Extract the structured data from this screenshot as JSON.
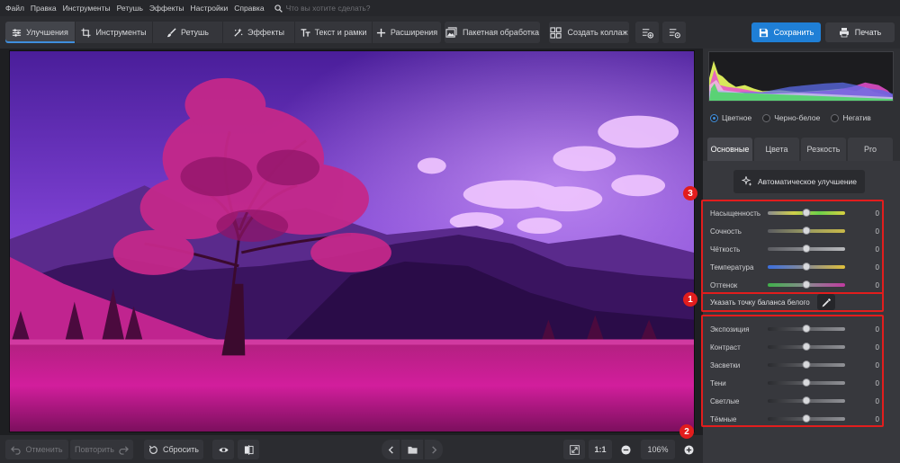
{
  "menu": {
    "items": [
      "Файл",
      "Правка",
      "Инструменты",
      "Ретушь",
      "Эффекты",
      "Настройки",
      "Справка"
    ],
    "search_placeholder": "Что вы хотите сделать?"
  },
  "toolbar": {
    "tabs": [
      {
        "label": "Улучшения",
        "icon": "sliders-icon"
      },
      {
        "label": "Инструменты",
        "icon": "crop-icon"
      },
      {
        "label": "Ретушь",
        "icon": "brush-icon"
      },
      {
        "label": "Эффекты",
        "icon": "sparkle-icon"
      },
      {
        "label": "Текст и рамки",
        "icon": "text-icon"
      },
      {
        "label": "Расширения",
        "icon": "plus-icon"
      }
    ],
    "batch_label": "Пакетная обработка",
    "collage_label": "Создать коллаж",
    "save_label": "Сохранить",
    "print_label": "Печать"
  },
  "bottombar": {
    "undo_label": "Отменить",
    "redo_label": "Повторить",
    "reset_label": "Сбросить",
    "ratio_label": "1:1",
    "zoom_value": "106%"
  },
  "panel": {
    "color_modes": [
      {
        "label": "Цветное",
        "selected": true
      },
      {
        "label": "Черно-белое",
        "selected": false
      },
      {
        "label": "Негатив",
        "selected": false
      }
    ],
    "tabs": [
      "Основные",
      "Цвета",
      "Резкость",
      "Pro"
    ],
    "auto_button": "Автоматическое улучшение",
    "white_balance_label": "Указать точку баланса белого",
    "sliders_color": [
      {
        "label": "Насыщенность",
        "value": "0",
        "level": 0.5
      },
      {
        "label": "Сочность",
        "value": "0",
        "level": 0.5
      },
      {
        "label": "Чёткость",
        "value": "0",
        "level": 0.5
      },
      {
        "label": "Температура",
        "value": "0",
        "level": 0.5
      },
      {
        "label": "Оттенок",
        "value": "0",
        "level": 0.5
      }
    ],
    "sliders_light": [
      {
        "label": "Экспозиция",
        "value": "0",
        "level": 0.5
      },
      {
        "label": "Контраст",
        "value": "0",
        "level": 0.5
      },
      {
        "label": "Засветки",
        "value": "0",
        "level": 0.5
      },
      {
        "label": "Тени",
        "value": "0",
        "level": 0.5
      },
      {
        "label": "Светлые",
        "value": "0",
        "level": 0.5
      },
      {
        "label": "Тёмные",
        "value": "0",
        "level": 0.5
      }
    ]
  },
  "annotations": {
    "badge1": "1",
    "badge2": "2",
    "badge3": "3"
  },
  "colors": {
    "accent": "#1f7fd6",
    "highlight_box": "#e21d1d"
  }
}
